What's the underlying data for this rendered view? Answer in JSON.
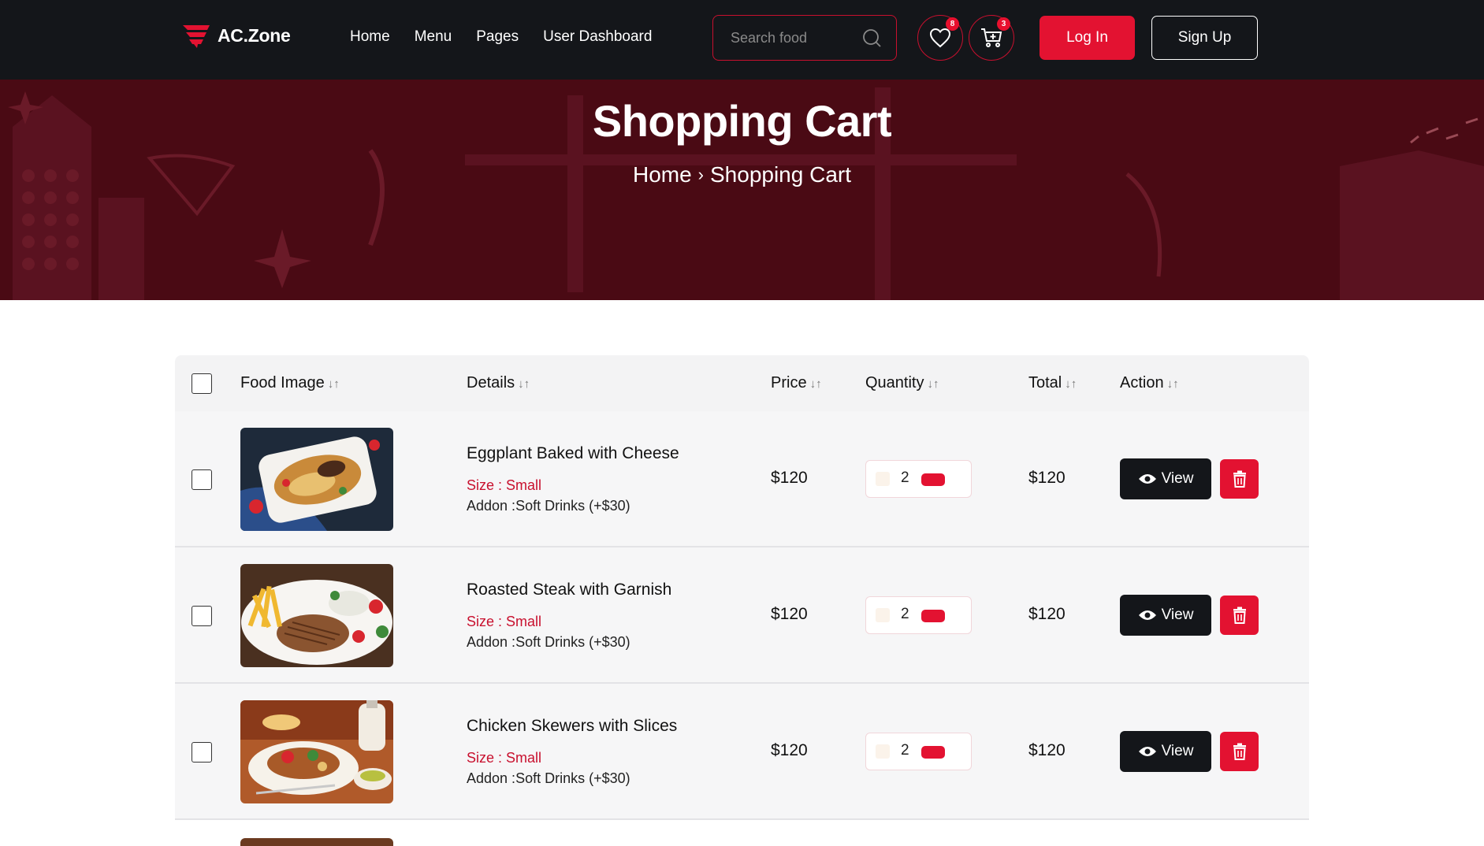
{
  "brand": {
    "name": "AC.Zone"
  },
  "nav": {
    "links": [
      "Home",
      "Menu",
      "Pages",
      "User Dashboard"
    ]
  },
  "search": {
    "placeholder": "Search food",
    "icon": "search-icon"
  },
  "wishlist": {
    "count": "8",
    "icon": "heart-icon"
  },
  "cart": {
    "count": "3",
    "icon": "cart-icon"
  },
  "auth": {
    "login_label": "Log In",
    "signup_label": "Sign Up"
  },
  "hero": {
    "title": "Shopping Cart",
    "breadcrumb": {
      "home": "Home",
      "separator": "›",
      "current": "Shopping Cart"
    }
  },
  "table": {
    "headers": {
      "image": "Food Image",
      "details": "Details",
      "price": "Price",
      "quantity": "Quantity",
      "total": "Total",
      "action": "Action"
    },
    "sort_glyph": "↓↑",
    "rows": [
      {
        "name": "Eggplant Baked with Cheese",
        "size": "Size : Small",
        "addon_label": "Addon :",
        "addon": "Soft Drinks (+$30)",
        "price": "$120",
        "quantity": "2",
        "total": "$120",
        "view_label": "View"
      },
      {
        "name": "Roasted Steak with Garnish",
        "size": "Size : Small",
        "addon_label": "Addon :",
        "addon": "Soft Drinks (+$30)",
        "price": "$120",
        "quantity": "2",
        "total": "$120",
        "view_label": "View"
      },
      {
        "name": "Chicken Skewers with Slices",
        "size": "Size : Small",
        "addon_label": "Addon :",
        "addon": "Soft Drinks (+$30)",
        "price": "$120",
        "quantity": "2",
        "total": "$120",
        "view_label": "View"
      }
    ]
  },
  "colors": {
    "accent": "#e31231",
    "nav_bg": "#14161a",
    "hero_bg": "#4a0a14",
    "row_bg": "#f6f6f7"
  }
}
